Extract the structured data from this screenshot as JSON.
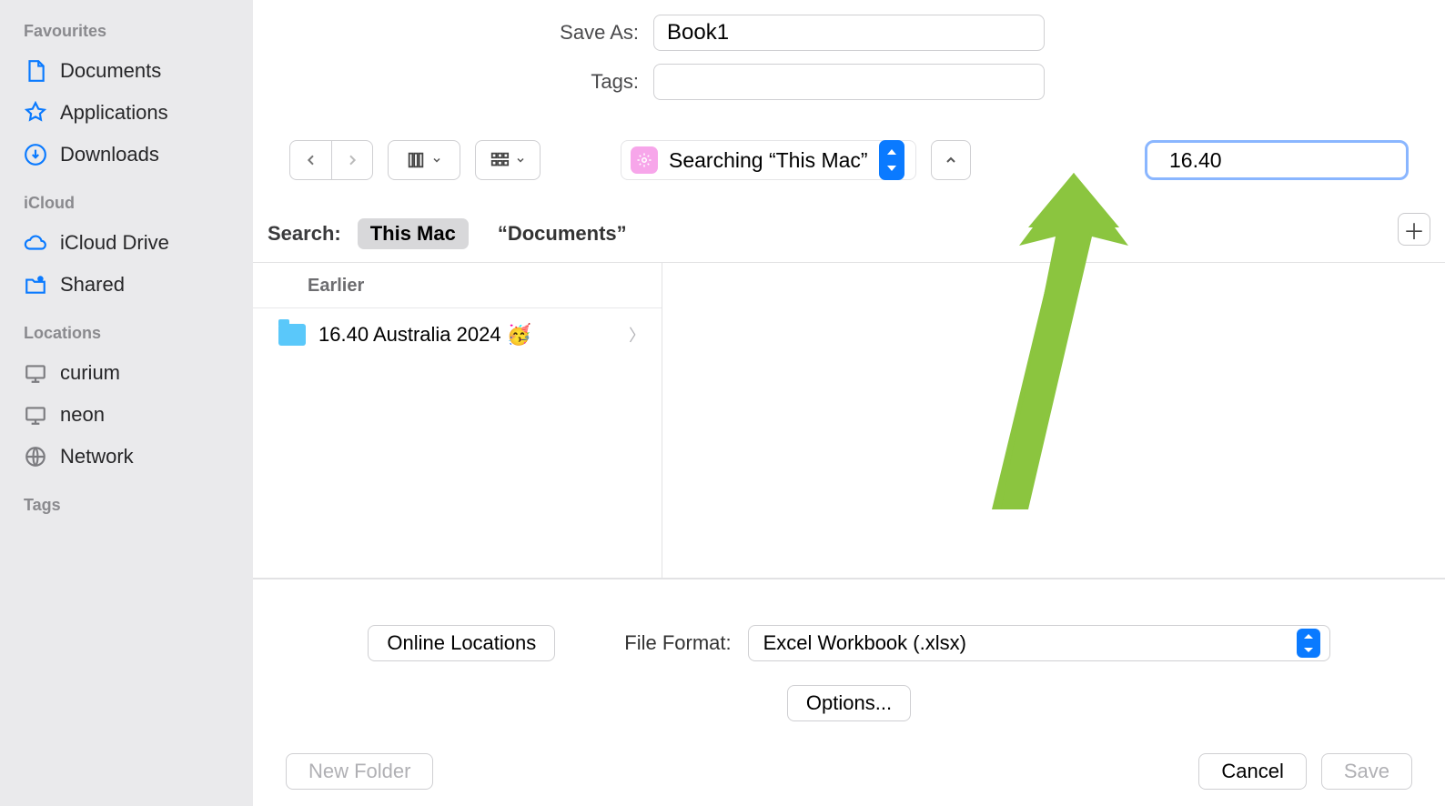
{
  "sidebar": {
    "favourites_title": "Favourites",
    "items_fav": [
      "Documents",
      "Applications",
      "Downloads"
    ],
    "icloud_title": "iCloud",
    "items_cloud": [
      "iCloud Drive",
      "Shared"
    ],
    "locations_title": "Locations",
    "items_loc": [
      "curium",
      "neon",
      "Network"
    ],
    "tags_title": "Tags"
  },
  "header": {
    "save_as_label": "Save As:",
    "save_as_value": "Book1",
    "tags_label": "Tags:",
    "tags_value": ""
  },
  "toolbar": {
    "location_text": "Searching “This Mac”",
    "search_value": "16.40"
  },
  "scope": {
    "search_label": "Search:",
    "scope_this_mac": "This Mac",
    "scope_documents": "“Documents”"
  },
  "results": {
    "group_label": "Earlier",
    "rows": [
      {
        "name": "16.40 Australia 2024 🥳"
      }
    ]
  },
  "bottom": {
    "online_locations": "Online Locations",
    "file_format_label": "File Format:",
    "file_format_value": "Excel Workbook (.xlsx)",
    "options_label": "Options..."
  },
  "footer": {
    "new_folder": "New Folder",
    "cancel": "Cancel",
    "save": "Save"
  }
}
